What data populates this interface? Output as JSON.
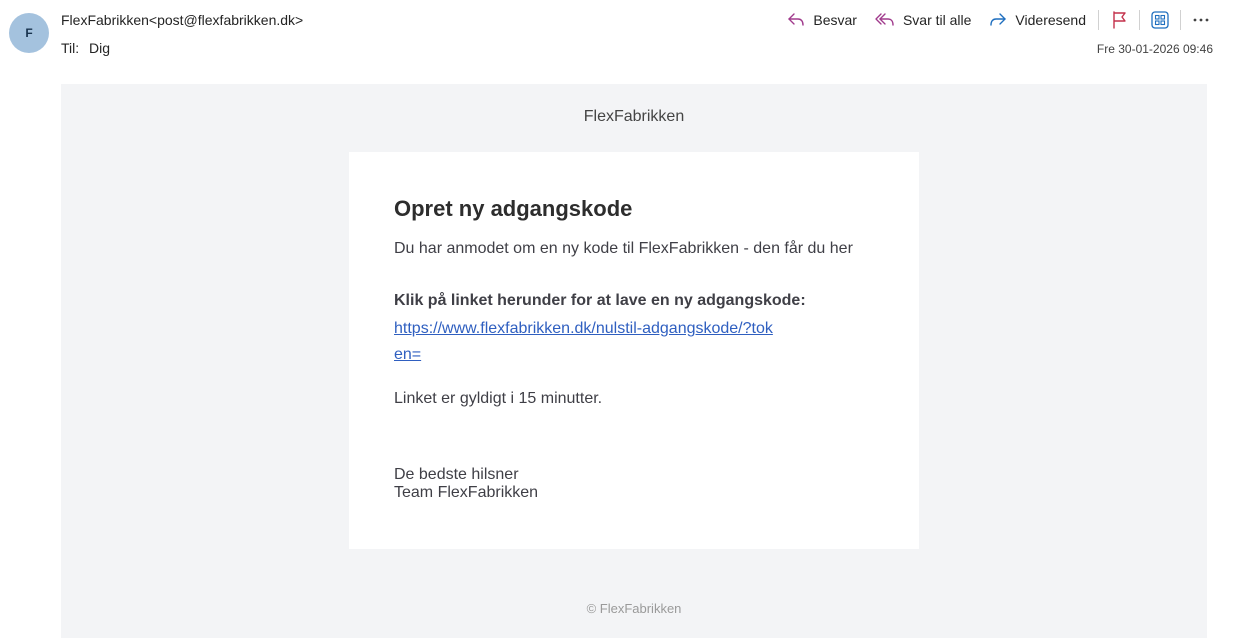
{
  "header": {
    "avatar_initial": "F",
    "sender": "FlexFabrikken<post@flexfabrikken.dk>",
    "to_label": "Til:",
    "to_value": "Dig",
    "date": "Fre 30-01-2026 09:46"
  },
  "actions": {
    "reply": "Besvar",
    "reply_all": "Svar til alle",
    "forward": "Videresend",
    "icons": [
      "reply-icon",
      "reply-all-icon",
      "forward-icon",
      "flag-icon",
      "apps-icon",
      "more-icon"
    ]
  },
  "colors": {
    "reply_accent": "#a03a8c",
    "forward_accent": "#1f6fbf",
    "flag": "#c4314b",
    "link": "#2f5fc0",
    "mail_background": "#f3f4f6"
  },
  "email": {
    "brand": "FlexFabrikken",
    "title": "Opret ny adgangskode",
    "intro": "Du har anmodet om en ny kode til FlexFabrikken - den får du her",
    "instruction": "Klik på linket herunder for at lave en ny adgangskode:",
    "link": "https://www.flexfabrikken.dk/nulstil-adgangskode/?token=",
    "validity": "Linket er gyldigt i 15 minutter.",
    "regards_line1": "De bedste hilsner",
    "regards_line2": "Team FlexFabrikken",
    "footer": "© FlexFabrikken"
  }
}
